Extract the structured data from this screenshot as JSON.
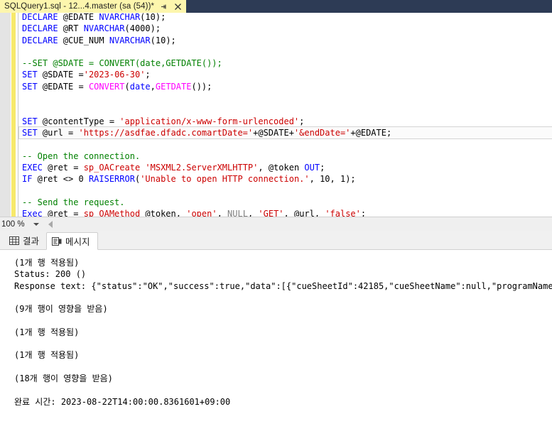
{
  "window": {
    "tab": {
      "title": "SQLQuery1.sql - 12...4.master (sa (54))*",
      "pin_tooltip": "Pin Tab",
      "close_tooltip": "Close"
    },
    "background_color": "#2d3b55",
    "tab_color": "#fdf6ad"
  },
  "editor": {
    "zoom_level": "100 %",
    "lines": [
      {
        "id": "line-declare-edate",
        "clipped": true,
        "current": false,
        "tokens": [
          {
            "t": "DECLARE",
            "c": "kw"
          },
          {
            "t": " @EDATE ",
            "c": "blk"
          },
          {
            "t": "NVARCHAR",
            "c": "kw"
          },
          {
            "t": "(",
            "c": "blk"
          },
          {
            "t": "10",
            "c": "blk"
          },
          {
            "t": ");",
            "c": "blk"
          }
        ]
      },
      {
        "id": "line-declare-rt",
        "current": false,
        "tokens": [
          {
            "t": "DECLARE",
            "c": "kw"
          },
          {
            "t": " @RT ",
            "c": "blk"
          },
          {
            "t": "NVARCHAR",
            "c": "kw"
          },
          {
            "t": "(",
            "c": "blk"
          },
          {
            "t": "4000",
            "c": "blk"
          },
          {
            "t": ");",
            "c": "blk"
          }
        ]
      },
      {
        "id": "line-declare-cuenum",
        "current": false,
        "tokens": [
          {
            "t": "DECLARE",
            "c": "kw"
          },
          {
            "t": " @CUE_NUM ",
            "c": "blk"
          },
          {
            "t": "NVARCHAR",
            "c": "kw"
          },
          {
            "t": "(",
            "c": "blk"
          },
          {
            "t": "10",
            "c": "blk"
          },
          {
            "t": ");",
            "c": "blk"
          }
        ]
      },
      {
        "id": "line-blank-1",
        "current": false,
        "tokens": []
      },
      {
        "id": "line-comment-set-sdate",
        "current": false,
        "tokens": [
          {
            "t": "--SET @SDATE = CONVERT(date,GETDATE());",
            "c": "cmt"
          }
        ]
      },
      {
        "id": "line-set-sdate",
        "current": false,
        "tokens": [
          {
            "t": "SET",
            "c": "kw"
          },
          {
            "t": " @SDATE =",
            "c": "blk"
          },
          {
            "t": "'2023-06-30'",
            "c": "str"
          },
          {
            "t": ";",
            "c": "blk"
          }
        ]
      },
      {
        "id": "line-set-edate",
        "current": false,
        "tokens": [
          {
            "t": "SET",
            "c": "kw"
          },
          {
            "t": " @EDATE = ",
            "c": "blk"
          },
          {
            "t": "CONVERT",
            "c": "fn"
          },
          {
            "t": "(",
            "c": "blk"
          },
          {
            "t": "date",
            "c": "kw"
          },
          {
            "t": ",",
            "c": "blk"
          },
          {
            "t": "GETDATE",
            "c": "fn"
          },
          {
            "t": "());",
            "c": "blk"
          }
        ]
      },
      {
        "id": "line-blank-2",
        "current": false,
        "tokens": []
      },
      {
        "id": "line-blank-3",
        "current": false,
        "tokens": []
      },
      {
        "id": "line-set-contenttype",
        "current": false,
        "tokens": [
          {
            "t": "SET",
            "c": "kw"
          },
          {
            "t": " @contentType = ",
            "c": "blk"
          },
          {
            "t": "'application/x-www-form-urlencoded'",
            "c": "str"
          },
          {
            "t": ";",
            "c": "blk"
          }
        ]
      },
      {
        "id": "line-set-url",
        "current": true,
        "tokens": [
          {
            "t": "SET",
            "c": "kw"
          },
          {
            "t": " @url = ",
            "c": "blk"
          },
          {
            "t": "'https://asdfae.dfadc.comartDate='",
            "c": "str"
          },
          {
            "t": "+@SDATE+",
            "c": "blk"
          },
          {
            "t": "'&endDate='",
            "c": "str"
          },
          {
            "t": "+@EDATE;",
            "c": "blk"
          }
        ]
      },
      {
        "id": "line-blank-4",
        "current": false,
        "tokens": []
      },
      {
        "id": "line-comment-open",
        "current": false,
        "tokens": [
          {
            "t": "-- Open the connection.",
            "c": "cmt"
          }
        ]
      },
      {
        "id": "line-exec-oacreate",
        "current": false,
        "tokens": [
          {
            "t": "EXEC",
            "c": "kw"
          },
          {
            "t": " @ret = ",
            "c": "blk"
          },
          {
            "t": "sp_OACreate",
            "c": "str"
          },
          {
            "t": " ",
            "c": "blk"
          },
          {
            "t": "'MSXML2.ServerXMLHTTP'",
            "c": "str"
          },
          {
            "t": ", @token ",
            "c": "blk"
          },
          {
            "t": "OUT",
            "c": "kw"
          },
          {
            "t": ";",
            "c": "blk"
          }
        ]
      },
      {
        "id": "line-if-raiserror",
        "current": false,
        "tokens": [
          {
            "t": "IF",
            "c": "kw"
          },
          {
            "t": " @ret <> 0 ",
            "c": "blk"
          },
          {
            "t": "RAISERROR",
            "c": "kw"
          },
          {
            "t": "(",
            "c": "blk"
          },
          {
            "t": "'Unable to open HTTP connection.'",
            "c": "str"
          },
          {
            "t": ", 10, 1);",
            "c": "blk"
          }
        ]
      },
      {
        "id": "line-blank-5",
        "current": false,
        "tokens": []
      },
      {
        "id": "line-comment-send",
        "current": false,
        "tokens": [
          {
            "t": "-- Send the request.",
            "c": "cmt"
          }
        ]
      },
      {
        "id": "line-exec-oamethod",
        "current": false,
        "tokens": [
          {
            "t": "Exec",
            "c": "kw"
          },
          {
            "t": " @ret = ",
            "c": "blk"
          },
          {
            "t": "sp_OAMethod",
            "c": "str"
          },
          {
            "t": " @token, ",
            "c": "blk"
          },
          {
            "t": "'open'",
            "c": "str"
          },
          {
            "t": ", ",
            "c": "blk"
          },
          {
            "t": "NULL",
            "c": "gray"
          },
          {
            "t": ", ",
            "c": "blk"
          },
          {
            "t": "'GET'",
            "c": "str"
          },
          {
            "t": ", @url, ",
            "c": "blk"
          },
          {
            "t": "'false'",
            "c": "str"
          },
          {
            "t": ";",
            "c": "blk"
          }
        ]
      }
    ]
  },
  "results_pane": {
    "tabs": [
      {
        "id": "tab-results",
        "label": "결과",
        "icon": "grid-icon",
        "active": false
      },
      {
        "id": "tab-messages",
        "label": "메시지",
        "icon": "message-icon",
        "active": true
      }
    ],
    "messages": [
      "(1개 행 적용됨)",
      "Status: 200 ()",
      "Response text: {\"status\":\"OK\",\"success\":true,\"data\":[{\"cueSheetId\":42185,\"cueSheetName\":null,\"programName\":\"",
      "",
      "(9개 행이 영향을 받음)",
      "",
      "(1개 행 적용됨)",
      "",
      "(1개 행 적용됨)",
      "",
      "(18개 행이 영향을 받음)",
      "",
      "완료 시간: 2023-08-22T14:00:00.8361601+09:00"
    ]
  }
}
